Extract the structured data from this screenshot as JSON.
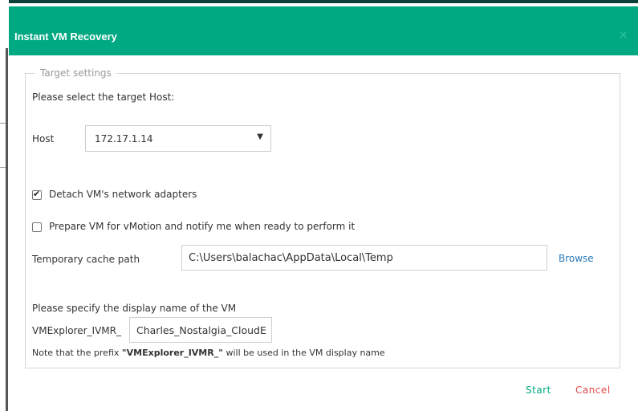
{
  "dialog": {
    "title": "Instant VM Recovery",
    "close_icon": "×"
  },
  "target_settings": {
    "legend": "Target settings",
    "select_host_prompt": "Please select the target Host:",
    "host_label": "Host",
    "host_value": "172.17.1.14",
    "host_dropdown_arrow": "▼",
    "detach_adapters": {
      "label": "Detach VM's network adapters",
      "checked": true
    },
    "prepare_vmotion": {
      "label": "Prepare VM for vMotion and notify me when ready to perform it",
      "checked": false
    },
    "cache_path_label": "Temporary cache path",
    "cache_path_value": "C:\\Users\\balachac\\AppData\\Local\\Temp",
    "browse_label": "Browse",
    "display_name_prompt": "Please specify the display name of the VM",
    "prefix_label": "VMExplorer_IVMR_",
    "display_name_value": "Charles_Nostalgia_CloudE",
    "note_prefix": "Note that the prefix ",
    "note_bold": "\"VMExplorer_IVMR_\"",
    "note_suffix": " will be used in the VM display name"
  },
  "footer": {
    "start_label": "Start",
    "cancel_label": "Cancel"
  },
  "colors": {
    "title_bar": "#01a982",
    "start": "#01a982",
    "cancel": "#e04a4a",
    "link": "#2a7ab8"
  }
}
